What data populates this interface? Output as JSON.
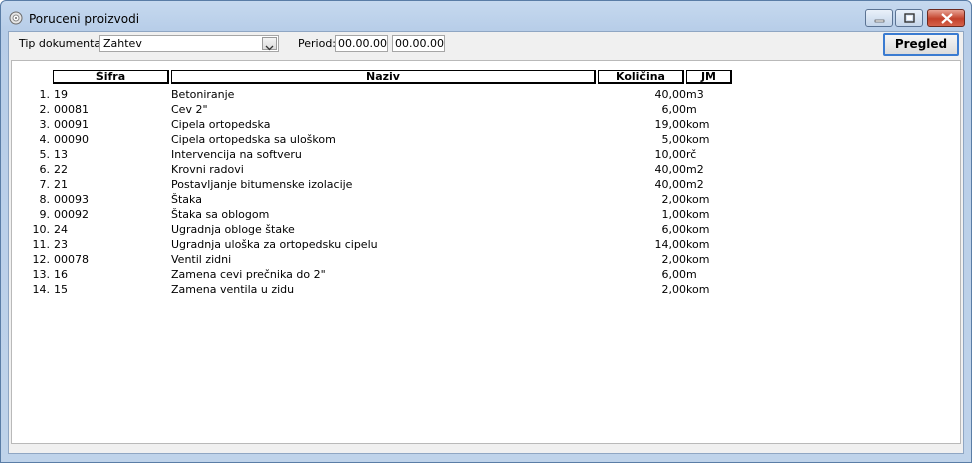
{
  "window": {
    "title": "Poruceni proizvodi"
  },
  "toolbar": {
    "tip_label": "Tip dokumenta:",
    "tip_value": "Zahtev",
    "period_label": "Period:",
    "period_from": "00.00.00",
    "period_to": "00.00.00",
    "pregled_label": "Pregled"
  },
  "table": {
    "headers": {
      "sifra": "Šifra",
      "naziv": "Naziv",
      "kolicina": "Količina",
      "jm": "JM"
    },
    "rows": [
      {
        "num": "1.",
        "sifra": "19",
        "naziv": "Betoniranje",
        "kolicina": "40,00",
        "jm": "m3"
      },
      {
        "num": "2.",
        "sifra": "00081",
        "naziv": "Cev 2\"",
        "kolicina": "6,00",
        "jm": "m"
      },
      {
        "num": "3.",
        "sifra": "00091",
        "naziv": "Cipela ortopedska",
        "kolicina": "19,00",
        "jm": "kom"
      },
      {
        "num": "4.",
        "sifra": "00090",
        "naziv": "Cipela ortopedska sa uloškom",
        "kolicina": "5,00",
        "jm": "kom"
      },
      {
        "num": "5.",
        "sifra": "13",
        "naziv": "Intervencija na softveru",
        "kolicina": "10,00",
        "jm": "rč"
      },
      {
        "num": "6.",
        "sifra": "22",
        "naziv": "Krovni radovi",
        "kolicina": "40,00",
        "jm": "m2"
      },
      {
        "num": "7.",
        "sifra": "21",
        "naziv": "Postavljanje bitumenske izolacije",
        "kolicina": "40,00",
        "jm": "m2"
      },
      {
        "num": "8.",
        "sifra": "00093",
        "naziv": "Štaka",
        "kolicina": "2,00",
        "jm": "kom"
      },
      {
        "num": "9.",
        "sifra": "00092",
        "naziv": "Štaka sa oblogom",
        "kolicina": "1,00",
        "jm": "kom"
      },
      {
        "num": "10.",
        "sifra": "24",
        "naziv": "Ugradnja obloge štake",
        "kolicina": "6,00",
        "jm": "kom"
      },
      {
        "num": "11.",
        "sifra": "23",
        "naziv": "Ugradnja uloška za ortopedsku cipelu",
        "kolicina": "14,00",
        "jm": "kom"
      },
      {
        "num": "12.",
        "sifra": "00078",
        "naziv": "Ventil zidni",
        "kolicina": "2,00",
        "jm": "kom"
      },
      {
        "num": "13.",
        "sifra": "16",
        "naziv": "Zamena cevi prečnika do 2\"",
        "kolicina": "6,00",
        "jm": "m"
      },
      {
        "num": "14.",
        "sifra": "15",
        "naziv": "Zamena ventila u zidu",
        "kolicina": "2,00",
        "jm": "kom"
      }
    ]
  }
}
